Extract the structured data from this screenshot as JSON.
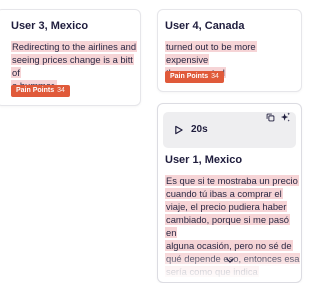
{
  "cards": [
    {
      "title": "User 3, Mexico",
      "quote_lines": [
        "Redirecting to the airlines and",
        "seeing prices change is a bitt of",
        "a bummer."
      ],
      "tag": {
        "label": "Pain Points",
        "count": "34"
      }
    },
    {
      "title": "User 4, Canada",
      "quote_lines": [
        "turned out to be more expensive",
        "than expected"
      ],
      "tag": {
        "label": "Pain Points",
        "count": "34"
      }
    },
    {
      "title": "User 1, Mexico",
      "duration": "20s",
      "quote_lines": [
        "Es que si te mostraba un precio",
        "cuando tú ibas a comprar el",
        "viaje, el precio pudiera haber",
        "cambiado, porque si me pasó en",
        "alguna ocasión, pero no sé de",
        "qué depende eso, entonces esa",
        "sería como que indica"
      ]
    }
  ],
  "icons": {
    "play": "play-icon",
    "copy": "copy-icon",
    "sparkle": "sparkle-icon",
    "expand": "chevron-down-icon"
  },
  "colors": {
    "highlight": "#f6d4d6",
    "tag": "#e05a3a",
    "title": "#1f1d3d",
    "audio_bar": "#eeeef0"
  }
}
